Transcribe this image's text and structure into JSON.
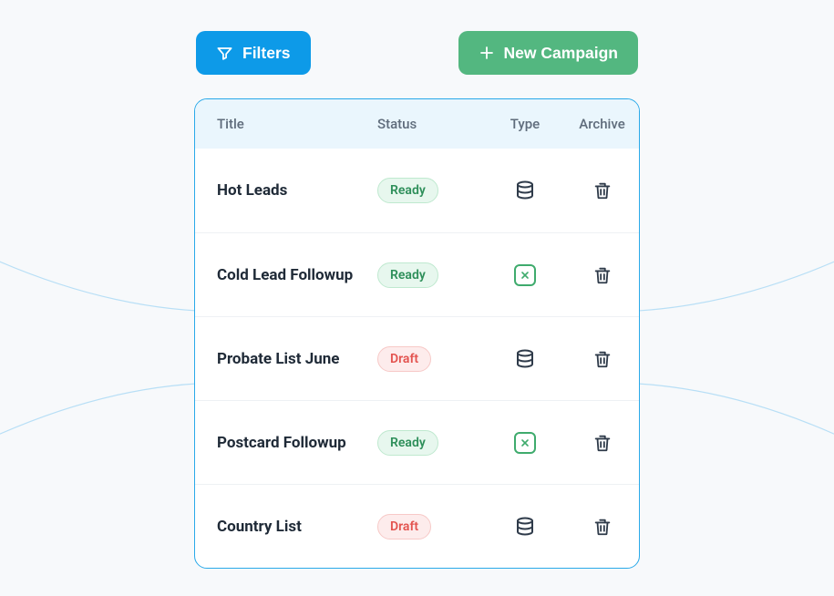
{
  "toolbar": {
    "filters_label": "Filters",
    "new_campaign_label": "New Campaign"
  },
  "table": {
    "headers": {
      "title": "Title",
      "status": "Status",
      "type": "Type",
      "archive": "Archive"
    },
    "rows": [
      {
        "title": "Hot Leads",
        "status": "Ready",
        "status_kind": "ready",
        "type_icon": "database"
      },
      {
        "title": "Cold Lead Followup",
        "status": "Ready",
        "status_kind": "ready",
        "type_icon": "x-box"
      },
      {
        "title": "Probate List June",
        "status": "Draft",
        "status_kind": "draft",
        "type_icon": "database"
      },
      {
        "title": "Postcard Followup",
        "status": "Ready",
        "status_kind": "ready",
        "type_icon": "x-box"
      },
      {
        "title": "Country List",
        "status": "Draft",
        "status_kind": "draft",
        "type_icon": "database"
      }
    ]
  }
}
